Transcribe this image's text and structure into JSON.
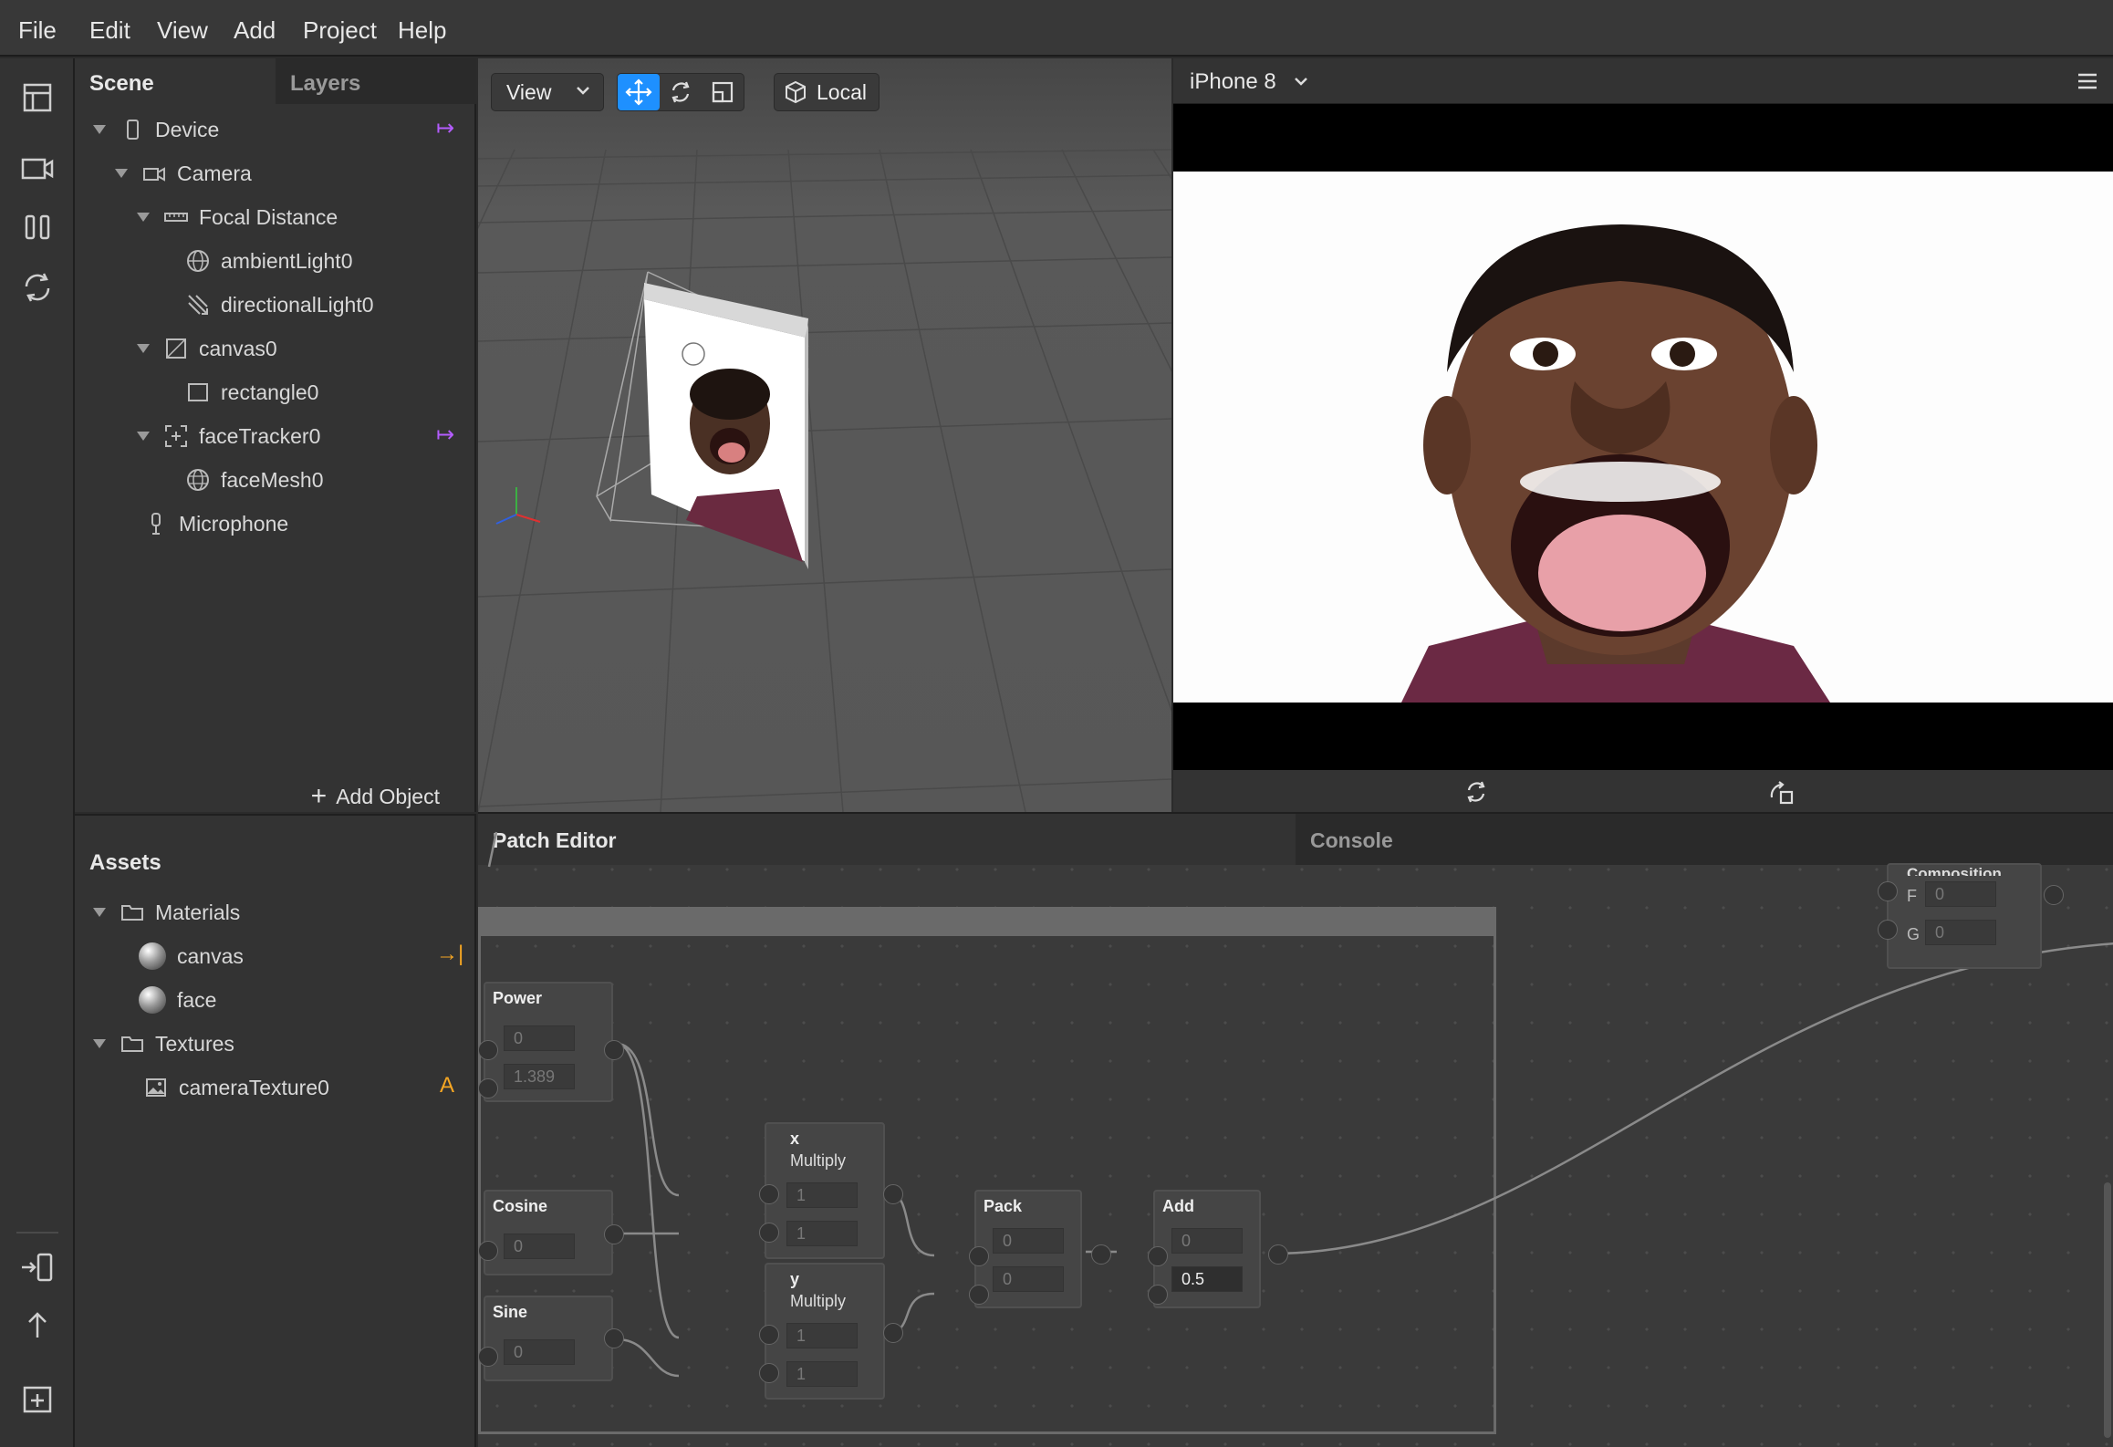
{
  "menu": [
    "File",
    "Edit",
    "View",
    "Add",
    "Project",
    "Help"
  ],
  "scene": {
    "tabs": [
      "Scene",
      "Layers"
    ],
    "tree": {
      "device": "Device",
      "camera": "Camera",
      "focal": "Focal Distance",
      "ambient": "ambientLight0",
      "directional": "directionalLight0",
      "canvas": "canvas0",
      "rectangle": "rectangle0",
      "facetracker": "faceTracker0",
      "facemesh": "faceMesh0",
      "microphone": "Microphone"
    },
    "add_object": "Add Object"
  },
  "assets": {
    "title": "Assets",
    "materials": "Materials",
    "mat_canvas": "canvas",
    "mat_face": "face",
    "textures": "Textures",
    "tex_camera": "cameraTexture0",
    "tex_badge": "A"
  },
  "viewport": {
    "view_label": "View",
    "local_label": "Local"
  },
  "simulator": {
    "device": "iPhone 8"
  },
  "panels": {
    "patch_editor": "Patch Editor",
    "console": "Console"
  },
  "patch": {
    "power": {
      "title": "Power",
      "in1": "0",
      "in2": "1.389"
    },
    "cosine": {
      "title": "Cosine",
      "in1": "0"
    },
    "sine": {
      "title": "Sine",
      "in1": "0"
    },
    "mult_x": {
      "title": "x",
      "sub": "Multiply",
      "in1": "1",
      "in2": "1"
    },
    "mult_y": {
      "title": "y",
      "sub": "Multiply",
      "in1": "1",
      "in2": "1"
    },
    "pack": {
      "title": "Pack",
      "in1": "0",
      "in2": "0"
    },
    "add": {
      "title": "Add",
      "in1": "0",
      "in2": "0.5"
    },
    "composition": {
      "title": "Composition",
      "f_label": "F",
      "f_val": "0",
      "g_label": "G",
      "g_val": "0"
    }
  },
  "colors": {
    "accent_blue": "#1e90ff",
    "badge_purple": "#b45cff",
    "badge_orange": "#f5a623"
  }
}
